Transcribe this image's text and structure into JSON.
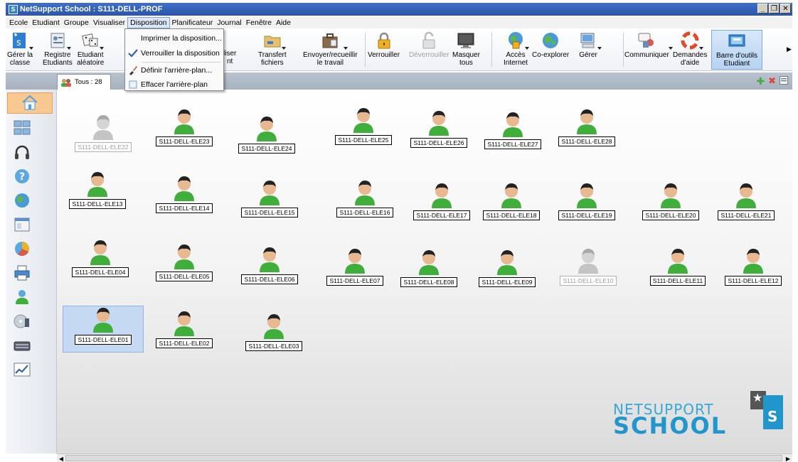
{
  "window": {
    "title": "NetSupport School : S111-DELL-PROF",
    "app_icon": "S",
    "controls": [
      "_",
      "̲·",
      "X"
    ]
  },
  "menubar": [
    "Ecole",
    "Etudiant",
    "Groupe",
    "Visualiser",
    "Disposition",
    "Planificateur",
    "Journal",
    "Fenêtre",
    "Aide"
  ],
  "toolbar": {
    "manage_class": [
      "Gérer la",
      "classe"
    ],
    "register": [
      "Registre",
      "Etudiants"
    ],
    "random_student": [
      "Etudiant",
      "aléatoire"
    ],
    "hidden_partial": [
      "liser",
      "nt"
    ],
    "transfer": [
      "Transfert",
      "fichiers"
    ],
    "send_collect": [
      "Envoyer/recueillir",
      "le travail"
    ],
    "lock": "Verrouiller",
    "unlock": "Déverrouiller",
    "mask_all": [
      "Masquer",
      "tous"
    ],
    "internet": [
      "Accès",
      "Internet"
    ],
    "co_explore": "Co-explorer",
    "manage": "Gérer",
    "communicate": "Communiquer",
    "help_requests": [
      "Demandes",
      "d'aide"
    ],
    "student_toolbar": [
      "Barre d'outils",
      "Etudiant"
    ]
  },
  "dropdown": {
    "items": [
      "Imprimer la disposition...",
      "Verrouiller la disposition",
      "Définir l'arrière-plan...",
      "Effacer l'arrière-plan"
    ],
    "checked_index": 1
  },
  "tab": {
    "label": "Tous : 28"
  },
  "students": {
    "s22": "S111-DELL-ELE22",
    "s23": "S111-DELL-ELE23",
    "s24": "S111-DELL-ELE24",
    "s25": "S111-DELL-ELE25",
    "s26": "S111-DELL-ELE26",
    "s27": "S111-DELL-ELE27",
    "s28": "S111-DELL-ELE28",
    "s13": "S111-DELL-ELE13",
    "s14": "S111-DELL-ELE14",
    "s15": "S111-DELL-ELE15",
    "s16": "S111-DELL-ELE16",
    "s17": "S111-DELL-ELE17",
    "s18": "S111-DELL-ELE18",
    "s19": "S111-DELL-ELE19",
    "s20": "S111-DELL-ELE20",
    "s21": "S111-DELL-ELE21",
    "s04": "S111-DELL-ELE04",
    "s05": "S111-DELL-ELE05",
    "s06": "S111-DELL-ELE06",
    "s07": "S111-DELL-ELE07",
    "s08": "S111-DELL-ELE08",
    "s09": "S111-DELL-ELE09",
    "s10": "S111-DELL-ELE10",
    "s11": "S111-DELL-ELE11",
    "s12": "S111-DELL-ELE12",
    "s01": "S111-DELL-ELE01",
    "s02": "S111-DELL-ELE02",
    "s03": "S111-DELL-ELE03",
    "offline": [
      "S111-DELL-ELE22",
      "S111-DELL-ELE10"
    ],
    "selected": "S111-DELL-ELE01"
  },
  "logo": {
    "line1": "NETSUPPORT",
    "line2": "SCHOOL",
    "badge": "S"
  },
  "colors": {
    "accent": "#2096cc",
    "online_avatar": "#3fae3a",
    "offline_avatar": "#b8b8b8",
    "selection": "#c6d9f3"
  }
}
